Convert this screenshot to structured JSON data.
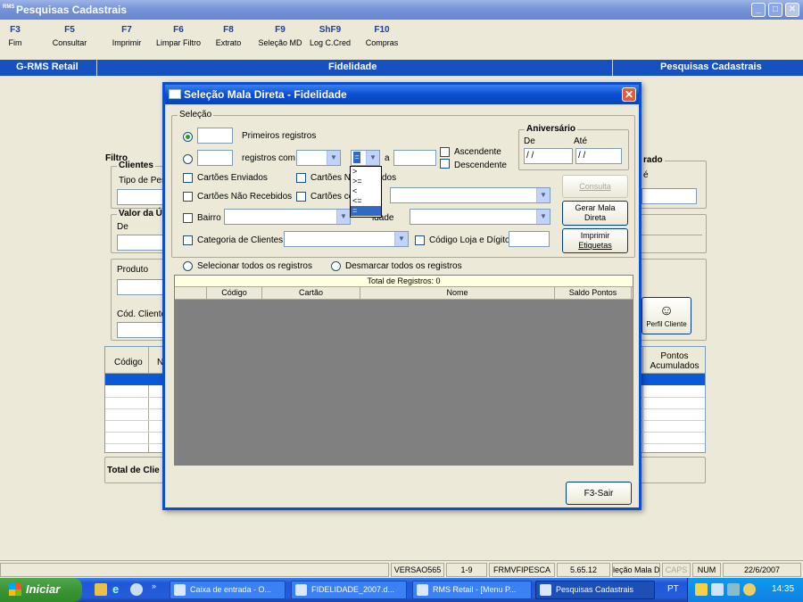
{
  "window": {
    "app_tag": "RMS",
    "title": "Pesquisas Cadastrais"
  },
  "toolbar": [
    {
      "key": "F3",
      "label": "Fim"
    },
    {
      "key": "F5",
      "label": "Consultar"
    },
    {
      "key": "F7",
      "label": "Imprimir"
    },
    {
      "key": "F6",
      "label": "Limpar Filtro"
    },
    {
      "key": "F8",
      "label": "Extrato"
    },
    {
      "key": "F9",
      "label": "Seleção MD"
    },
    {
      "key": "ShF9",
      "label": "Log C.Cred"
    },
    {
      "key": "F10",
      "label": "Compras"
    }
  ],
  "bluebar": {
    "left": "G-RMS Retail",
    "center": "Fidelidade",
    "right": "Pesquisas Cadastrais"
  },
  "bg": {
    "filtro": "Filtro",
    "clientes": "Clientes",
    "tipo": "Tipo de Pes",
    "valor": "Valor da Ú",
    "de": "De",
    "produto": "Produto",
    "cod_cliente": "Cód. Cliente",
    "rado": "rado",
    "e": "é",
    "perfil": "Perfil Cliente",
    "col_codigo": "Código",
    "col_n": "N",
    "pontos": "Pontos Acumulados",
    "total": "Total de Clie"
  },
  "dialog": {
    "title": "Seleção Mala Direta - Fidelidade",
    "selecao": "Seleção",
    "primeiros": "Primeiros registros",
    "registros_com": "registros com",
    "a": "a",
    "ascendente": "Ascendente",
    "descendente": "Descendente",
    "aniversario": "Aniversário",
    "de": "De",
    "ate": "Até",
    "date_de": "/ /",
    "date_ate": "/ /",
    "operator_value": "=",
    "operator_options": [
      ">",
      ">=",
      "<",
      "<=",
      "="
    ],
    "cartoes_enviados": "Cartões Enviados",
    "cartoes_nao_enviados_a": "Cartões Nã",
    "cartoes_nao_enviados_b": "dos",
    "cartoes_nao_recebidos": "Cartões Não Recebidos",
    "cartoes_co": "Cartões co",
    "bairro": "Bairro",
    "cidade": "idade",
    "categoria": "Categoria de Clientes",
    "codigo_loja": "Código Loja e Dígito",
    "btn_consulta": "Consulta",
    "btn_gerar_1": "Gerar Mala",
    "btn_gerar_2": "Direta",
    "btn_imprimir_1": "Imprimir",
    "btn_imprimir_2": "Etiquetas",
    "selecionar_todos": "Selecionar todos os registros",
    "desmarcar_todos": "Desmarcar todos os registros",
    "total_registros": "Total de Registros: 0",
    "columns": [
      "Código",
      "Cartão",
      "Nome",
      "Saldo Pontos"
    ],
    "btn_sair": "F3-Sair"
  },
  "status": [
    "VERSAO565",
    "1-9",
    "FRMVFIPESCA",
    "5.65.12",
    "leção Mala Dire",
    "CAPS",
    "NUM",
    "22/6/2007"
  ],
  "taskbar": {
    "start": "Iniciar",
    "tasks": [
      "Caixa de entrada - O...",
      "FIDELIDADE_2007.d...",
      "RMS Retail - [Menu P...",
      "Pesquisas Cadastrais"
    ],
    "lang": "PT",
    "clock": "14:35"
  }
}
